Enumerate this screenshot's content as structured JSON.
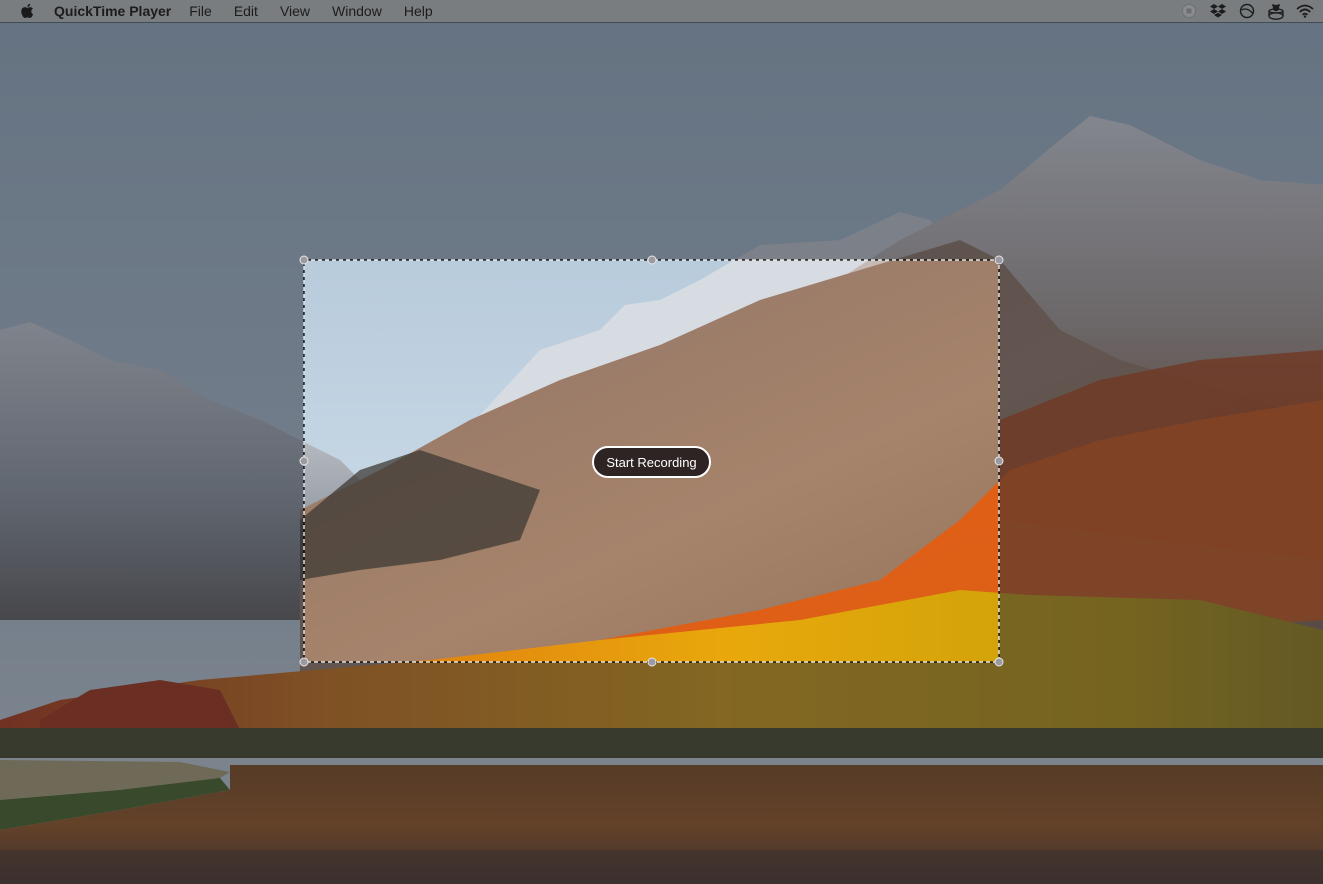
{
  "menubar": {
    "apple_icon": "apple-logo-icon",
    "app_name": "QuickTime Player",
    "items": [
      "File",
      "Edit",
      "View",
      "Window",
      "Help"
    ],
    "status_icons": [
      "stop-recording-icon",
      "dropbox-icon",
      "do-not-disturb-icon",
      "bear-cup-icon",
      "wifi-icon"
    ]
  },
  "wallpaper": {
    "description": "macOS High Sierra mountain lake wallpaper",
    "colors": {
      "sky_top": "#4b5968",
      "sky_bottom": "#5e6b76",
      "snow": "#c9ced4",
      "rock": "#7a6558",
      "orange_foliage": "#d9520f",
      "yellow_foliage": "#f2a40a",
      "lake": "#6e3f16"
    }
  },
  "capture": {
    "selection_border_color": "#ffffff",
    "handle_color": "#9a9aa0",
    "dim_overlay": "rgba(38,45,55,0.52)",
    "start_recording_label": "Start Recording"
  }
}
